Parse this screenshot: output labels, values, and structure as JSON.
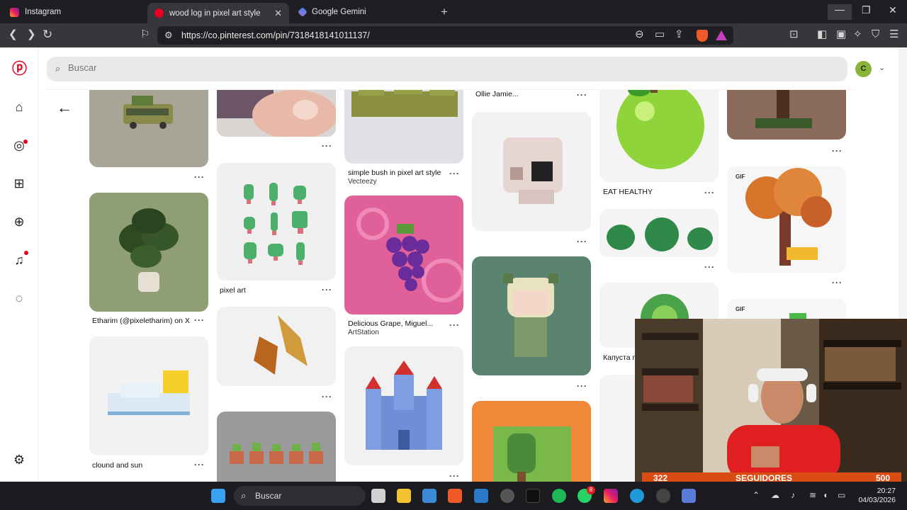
{
  "browser": {
    "tabs": [
      {
        "label": "Instagram"
      },
      {
        "label": "wood log in pixel art style"
      },
      {
        "label": "Google Gemini"
      }
    ],
    "url": "https://co.pinterest.com/pin/7318418141011137/"
  },
  "header": {
    "search_placeholder": "Buscar",
    "avatar_letter": "C"
  },
  "pins": {
    "col1": [
      {
        "title": ""
      },
      {
        "title": "Etharim (@pixeletharim) on X"
      },
      {
        "title": "clound and sun"
      }
    ],
    "col2": [
      {
        "title": ""
      },
      {
        "title": "pixel art"
      },
      {
        "title": ""
      },
      {
        "title": ""
      }
    ],
    "col3": [
      {
        "title": "simple bush in pixel art style",
        "source": "Vecteezy"
      },
      {
        "title": "Delicious Grape, Miguel...",
        "source": "ArtStation"
      },
      {
        "title": ""
      }
    ],
    "col4": [
      {
        "title": "Ollie Jamie..."
      },
      {
        "title": ""
      },
      {
        "title": ""
      },
      {
        "title": ""
      }
    ],
    "col5": [
      {
        "title": "EAT HEALTHY"
      },
      {
        "title": ""
      },
      {
        "title": "Капуста п"
      }
    ],
    "col6": [
      {
        "title": ""
      },
      {
        "title": "",
        "badge": "GIF"
      },
      {
        "title": "",
        "badge": "GIF"
      }
    ]
  },
  "stream": {
    "followers_current": "322",
    "followers_label": "SEGUIDORES",
    "followers_goal": "500"
  },
  "taskbar": {
    "search_label": "Buscar",
    "time": "20:27",
    "date": "04/03/2026",
    "whatsapp_badge": "8"
  }
}
